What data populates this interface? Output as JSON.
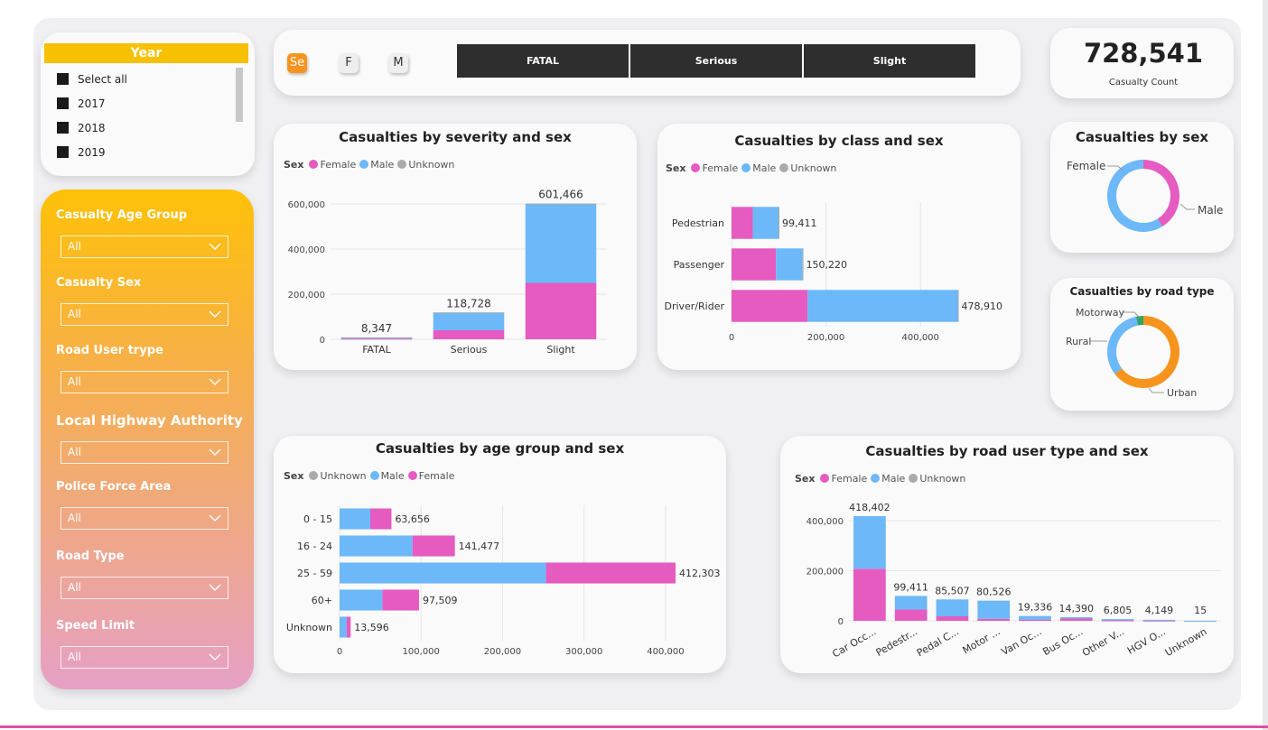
{
  "colors": {
    "female": "#e55bbf",
    "male": "#6cb8f8",
    "unknown": "#aaaaaa",
    "urban": "#f7941d",
    "rural": "#6cb8f8",
    "motorway": "#2ea36b",
    "accent": "#f7c000",
    "dark": "#2e2e2e"
  },
  "year_slicer": {
    "title": "Year",
    "items": [
      "Select all",
      "2017",
      "2018",
      "2019"
    ]
  },
  "filters": [
    {
      "label": "Casualty Age Group",
      "value": "All"
    },
    {
      "label": "Casualty Sex",
      "value": "All"
    },
    {
      "label": "Road User trype",
      "value": "All"
    },
    {
      "label": "Local Highway Authority",
      "value": "All"
    },
    {
      "label": "Police Force Area",
      "value": "All"
    },
    {
      "label": "Road Type",
      "value": "All"
    },
    {
      "label": "Speed Limit",
      "value": "All"
    }
  ],
  "sex_buttons": [
    "Se",
    "F",
    "M"
  ],
  "severity_buttons": [
    "FATAL",
    "Serious",
    "Slight"
  ],
  "kpi": {
    "value": "728,541",
    "label": "Casualty Count"
  },
  "legend_sex_title": "Sex",
  "legend_labels": {
    "female": "Female",
    "male": "Male",
    "unknown": "Unknown"
  },
  "chart_data": [
    {
      "id": "severity",
      "type": "bar",
      "title": "Casualties by severity and sex",
      "stacked": true,
      "categories": [
        "FATAL",
        "Serious",
        "Slight"
      ],
      "series": [
        {
          "name": "Female",
          "values": [
            2500,
            40000,
            250000
          ]
        },
        {
          "name": "Male",
          "values": [
            5800,
            78700,
            351400
          ]
        },
        {
          "name": "Unknown",
          "values": [
            47,
            28,
            66
          ]
        }
      ],
      "totals": [
        "8,347",
        "118,728",
        "601,466"
      ],
      "yticks": [
        "0",
        "200,000",
        "400,000",
        "600,000"
      ],
      "ylim": [
        0,
        640000
      ]
    },
    {
      "id": "class",
      "type": "bar",
      "orientation": "horizontal",
      "title": "Casualties by class and sex",
      "stacked": true,
      "categories": [
        "Pedestrian",
        "Passenger",
        "Driver/Rider"
      ],
      "series": [
        {
          "name": "Female",
          "values": [
            45000,
            94000,
            161000
          ]
        },
        {
          "name": "Male",
          "values": [
            54400,
            56200,
            317900
          ]
        },
        {
          "name": "Unknown",
          "values": [
            11,
            20,
            10
          ]
        }
      ],
      "totals": [
        "99,411",
        "150,220",
        "478,910"
      ],
      "xticks": [
        "0",
        "200,000",
        "400,000"
      ],
      "xlim": [
        0,
        520000
      ]
    },
    {
      "id": "sex",
      "type": "pie",
      "donut": true,
      "title": "Casualties by sex",
      "slices": [
        {
          "name": "Female",
          "value": 300000
        },
        {
          "name": "Male",
          "value": 428400
        },
        {
          "name": "Unknown",
          "value": 141
        }
      ],
      "labels": [
        "Female",
        "Male"
      ]
    },
    {
      "id": "road_type",
      "type": "pie",
      "donut": true,
      "title": "Casualties by road type",
      "slices": [
        {
          "name": "Urban",
          "value": 470000
        },
        {
          "name": "Rural",
          "value": 235000
        },
        {
          "name": "Motorway",
          "value": 23500
        }
      ],
      "labels": [
        "Motorway",
        "Rural",
        "Urban"
      ]
    },
    {
      "id": "age",
      "type": "bar",
      "orientation": "horizontal",
      "title": "Casualties by age group and sex",
      "stacked": true,
      "categories": [
        "0 - 15",
        "16 - 24",
        "25 - 59",
        "60+",
        "Unknown"
      ],
      "series": [
        {
          "name": "Unknown",
          "values": [
            0,
            0,
            0,
            0,
            0
          ]
        },
        {
          "name": "Male",
          "values": [
            37656,
            89477,
            253303,
            52509,
            8596
          ]
        },
        {
          "name": "Female",
          "values": [
            26000,
            52000,
            159000,
            45000,
            5000
          ]
        }
      ],
      "legend_order": [
        "Unknown",
        "Male",
        "Female"
      ],
      "totals": [
        "63,656",
        "141,477",
        "412,303",
        "97,509",
        "13,596"
      ],
      "xticks": [
        "0",
        "100,000",
        "200,000",
        "300,000",
        "400,000"
      ],
      "xlim": [
        0,
        430000
      ]
    },
    {
      "id": "road_user",
      "type": "bar",
      "title": "Casualties by road user type and sex",
      "stacked": true,
      "categories": [
        "Car Occ...",
        "Pedestr...",
        "Pedal C...",
        "Motor ...",
        "Van Oc...",
        "Bus Oc...",
        "Other V...",
        "HGV O...",
        "Unknown"
      ],
      "series": [
        {
          "name": "Female",
          "values": [
            208000,
            45000,
            18000,
            8000,
            5000,
            9000,
            1800,
            1000,
            5
          ]
        },
        {
          "name": "Male",
          "values": [
            210402,
            54411,
            67507,
            72526,
            14336,
            5390,
            5005,
            3149,
            10
          ]
        },
        {
          "name": "Unknown",
          "values": [
            0,
            0,
            0,
            0,
            0,
            0,
            0,
            0,
            0
          ]
        }
      ],
      "totals": [
        "418,402",
        "99,411",
        "85,507",
        "80,526",
        "19,336",
        "14,390",
        "6,805",
        "4,149",
        "15"
      ],
      "yticks": [
        "0",
        "200,000",
        "400,000"
      ],
      "ylim": [
        0,
        440000
      ]
    }
  ]
}
